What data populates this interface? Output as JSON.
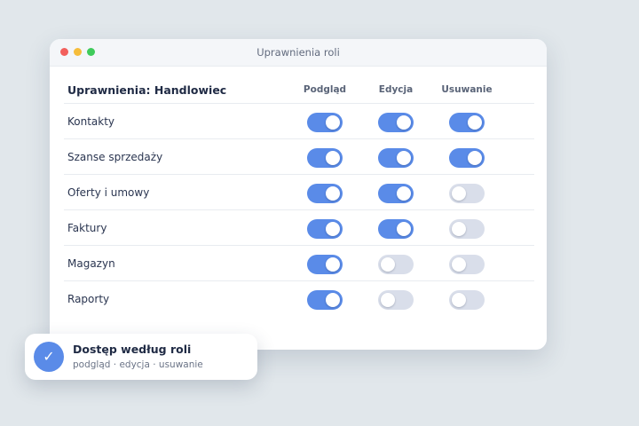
{
  "window": {
    "title": "Uprawnienia roli"
  },
  "table": {
    "title": "Uprawnienia: Handlowiec",
    "columns": [
      "Podgląd",
      "Edycja",
      "Usuwanie"
    ],
    "rows": [
      {
        "label": "Kontakty",
        "view": true,
        "edit": true,
        "delete": true
      },
      {
        "label": "Szanse sprzedaży",
        "view": true,
        "edit": true,
        "delete": true
      },
      {
        "label": "Oferty i umowy",
        "view": true,
        "edit": true,
        "delete": false
      },
      {
        "label": "Faktury",
        "view": true,
        "edit": true,
        "delete": false
      },
      {
        "label": "Magazyn",
        "view": true,
        "edit": false,
        "delete": false
      },
      {
        "label": "Raporty",
        "view": true,
        "edit": false,
        "delete": false
      }
    ]
  },
  "card": {
    "icon": "check-icon",
    "check_glyph": "✓",
    "title": "Dostęp według roli",
    "subtitle": "podgląd · edycja · usuwanie"
  },
  "colors": {
    "toggle_on": "#5a8be8",
    "toggle_off": "#d9deea",
    "background": "#e1e7eb",
    "traffic_red": "#f25f5c",
    "traffic_yellow": "#f6bd3b",
    "traffic_green": "#3fcb5b"
  }
}
